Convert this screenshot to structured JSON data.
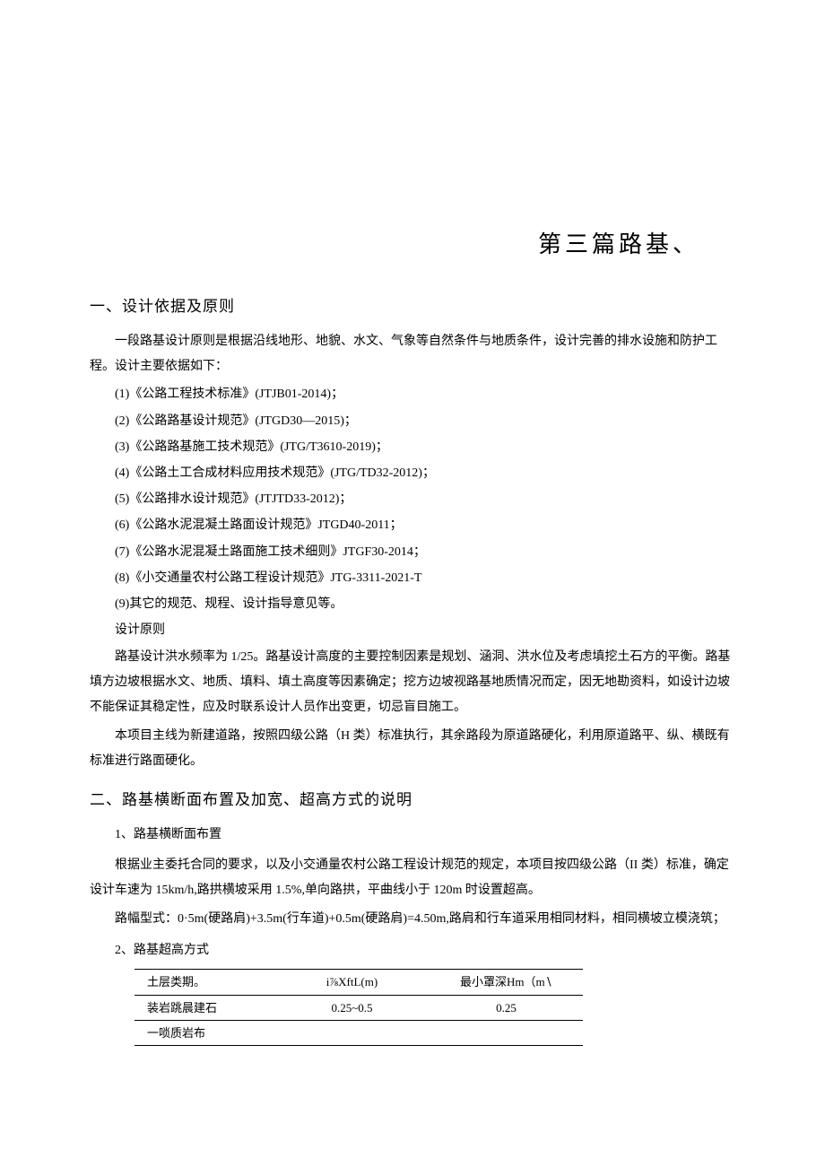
{
  "chapter": {
    "title": "第三篇路基、"
  },
  "section1": {
    "heading": "一、设计依据及原则",
    "intro": "一段路基设计原则是根据沿线地形、地貌、水文、气象等自然条件与地质条件，设计完善的排水设施和防护工程。设计主要依据如下：",
    "items": [
      "(1)《公路工程技术标准》(JTJB01-2014)；",
      "(2)《公路路基设计规范》(JTGD30—2015)；",
      "(3)《公路路基施工技术规范》(JTG/T3610-2019)；",
      "(4)《公路土工合成材料应用技术规范》(JTG/TD32-2012)；",
      "(5)《公路排水设计规范》(JTJTD33-2012)；",
      "(6)《公路水泥混凝土路面设计规范》JTGD40-2011；",
      "(7)《公路水泥混凝土路面施工技术细则》JTGF30-2014；",
      "(8)《小交通量农村公路工程设计规范》JTG-3311-2021-T",
      "(9)其它的规范、规程、设计指导意见等。"
    ],
    "principle_label": "设计原则",
    "principle_p1": "路基设计洪水频率为 1/25。路基设计高度的主要控制因素是规划、涵洞、洪水位及考虑填挖土石方的平衡。路基填方边坡根据水文、地质、填料、填土高度等因素确定；挖方边坡视路基地质情况而定，因无地勘资料，如设计边坡不能保证其稳定性，应及时联系设计人员作出变更，切忌盲目施工。",
    "principle_p2": "本项目主线为新建道路，按照四级公路（H 类）标准执行，其余路段为原道路硬化，利用原道路平、纵、横既有标准进行路面硬化。"
  },
  "section2": {
    "heading": "二、路基横断面布置及加宽、超高方式的说明",
    "sub1": "1、路基横断面布置",
    "p1": "根据业主委托合同的要求，以及小交通量农村公路工程设计规范的规定，本项目按四级公路（II 类）标准，确定设计车速为 15km/h,路拱横坡采用 1.5%,单向路拱，平曲线小于 120m 时设置超高。",
    "p2": "路幅型式：0·5m(硬路肩)+3.5m(行车道)+0.5m(硬路肩)=4.50m,路肩和行车道采用相同材料，相同横坡立模浇筑；",
    "sub2": "2、路基超高方式"
  },
  "table": {
    "headers": {
      "c1": "土层类期。",
      "c2": "i⅞XftL(m)",
      "c3": "最小罩深Hm（m∖"
    },
    "rows": [
      {
        "c1": "装岩跳晨建石",
        "c2": "0.25~0.5",
        "c3": "0.25"
      },
      {
        "c1": "一唢质岩布",
        "c2": "",
        "c3": ""
      }
    ]
  }
}
